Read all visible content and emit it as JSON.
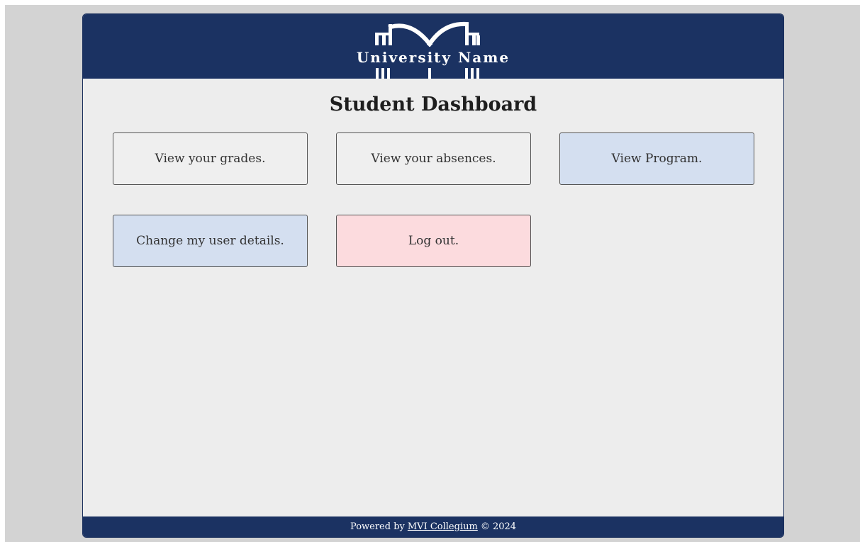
{
  "header": {
    "logo_text": "University Name"
  },
  "page": {
    "title": "Student Dashboard"
  },
  "tiles": [
    {
      "label": "View your grades."
    },
    {
      "label": "View your absences."
    },
    {
      "label": "View Program."
    },
    {
      "label": "Change my user details."
    },
    {
      "label": "Log out."
    }
  ],
  "footer": {
    "prefix": "Powered by",
    "link_text": "MVI Collegium",
    "suffix": "© 2024"
  },
  "colors": {
    "header_bg": "#1b3262",
    "page_bg": "#ededed",
    "tile_blue": "#d4dff0",
    "tile_pink": "#fcdbde"
  }
}
